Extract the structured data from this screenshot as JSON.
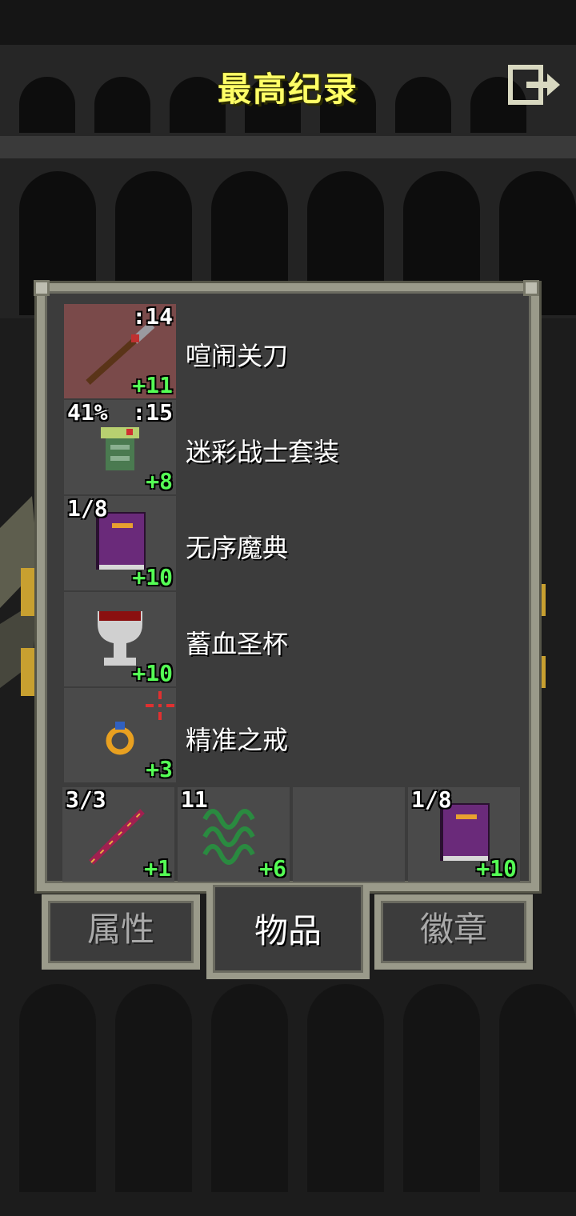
{
  "header": {
    "title": "最高纪录",
    "exit_icon": "exit-icon"
  },
  "items": [
    {
      "name": "喧闹关刀",
      "top_left": "",
      "top_right": ":14",
      "upgrade": "+11",
      "icon": "glaive-icon",
      "cursed": true
    },
    {
      "name": "迷彩战士套装",
      "top_left": "41%",
      "top_right": ":15",
      "upgrade": "+8",
      "icon": "armor-icon",
      "cursed": false
    },
    {
      "name": "无序魔典",
      "top_left": "1/8",
      "top_right": "",
      "upgrade": "+10",
      "icon": "tome-icon",
      "cursed": false
    },
    {
      "name": "蓄血圣杯",
      "top_left": "",
      "top_right": "",
      "upgrade": "+10",
      "icon": "chalice-icon",
      "cursed": false
    },
    {
      "name": "精准之戒",
      "top_left": "",
      "top_right": "",
      "upgrade": "+3",
      "icon": "ring-icon",
      "cursed": false
    }
  ],
  "quickslots": [
    {
      "top_left": "3/3",
      "upgrade": "+1",
      "icon": "wand-icon"
    },
    {
      "top_left": "11",
      "upgrade": "+6",
      "icon": "vine-icon"
    },
    {
      "top_left": "",
      "upgrade": "",
      "icon": ""
    },
    {
      "top_left": "1/8",
      "upgrade": "+10",
      "icon": "tome-icon"
    }
  ],
  "tabs": [
    {
      "label": "属性",
      "active": false
    },
    {
      "label": "物品",
      "active": true
    },
    {
      "label": "徽章",
      "active": false
    }
  ],
  "colors": {
    "title": "#ffff66",
    "upgrade": "#55ff55",
    "panel": "#3c3c3c",
    "border": "#9a9a8a"
  }
}
